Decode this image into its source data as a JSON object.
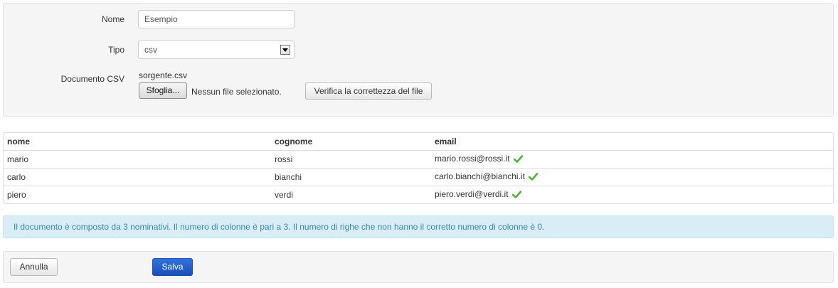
{
  "form": {
    "name_label": "Nome",
    "name_value": "Esempio",
    "type_label": "Tipo",
    "type_value": "csv",
    "doc_label": "Documento CSV",
    "current_file": "sorgente.csv",
    "browse_label": "Sfoglia...",
    "no_file_text": "Nessun file selezionato.",
    "verify_label": "Verifica la correttezza del file"
  },
  "table": {
    "headers": [
      "nome",
      "cognome",
      "email"
    ],
    "rows": [
      {
        "nome": "mario",
        "cognome": "rossi",
        "email": "mario.rossi@rossi.it",
        "valid": true
      },
      {
        "nome": "carlo",
        "cognome": "bianchi",
        "email": "carlo.bianchi@bianchi.it",
        "valid": true
      },
      {
        "nome": "piero",
        "cognome": "verdi",
        "email": "piero.verdi@verdi.it",
        "valid": true
      }
    ]
  },
  "info": {
    "message": "Il documento è composto da 3 nominativi. Il numero di colonne è pari a 3. Il numero di righe che non hanno il corretto numero di colonne è 0."
  },
  "actions": {
    "cancel_label": "Annulla",
    "save_label": "Salva"
  },
  "icons": {
    "valid": "checkmark-icon",
    "select": "dropdown-arrow-icon"
  },
  "colors": {
    "check": "#4fb33b",
    "info_bg": "#d9edf7",
    "info_text": "#3a87ad",
    "primary": "#2566cf"
  }
}
